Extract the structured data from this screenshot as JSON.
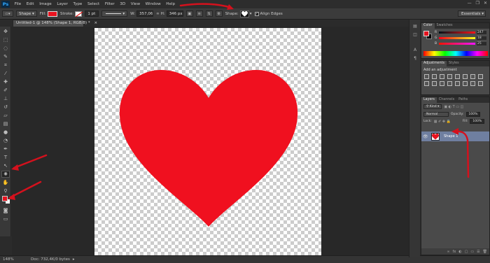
{
  "app": {
    "logo": "Ps"
  },
  "menu": [
    "File",
    "Edit",
    "Image",
    "Layer",
    "Type",
    "Select",
    "Filter",
    "3D",
    "View",
    "Window",
    "Help"
  ],
  "window_controls": [
    "—",
    "❐",
    "✕"
  ],
  "options_bar": {
    "mode": "Shape",
    "fill_label": "Fill:",
    "stroke_label": "Stroke:",
    "stroke_width": "1 pt",
    "w_label": "W:",
    "w_value": "357,06",
    "link": "∞",
    "h_label": "H:",
    "h_value": "346 px",
    "shape_label": "Shape:",
    "align_edges": "Align Edges",
    "workspace": "Essentials"
  },
  "document": {
    "tab": "Untitled-1 @ 148% (Shape 1, RGB/8) *",
    "close": "×",
    "zoom": "148%",
    "doc_info": "Doc: 732,4K/0 bytes",
    "heart_color": "#f0101f"
  },
  "color_panel": {
    "tabs": [
      "Color",
      "Swatches"
    ],
    "sliders": [
      {
        "ch": "R",
        "value": "247"
      },
      {
        "ch": "G",
        "value": "18"
      },
      {
        "ch": "B",
        "value": "25"
      }
    ]
  },
  "adjustments_panel": {
    "tabs": [
      "Adjustments",
      "Styles"
    ],
    "title": "Add an adjustment"
  },
  "layers_panel": {
    "tabs": [
      "Layers",
      "Channels",
      "Paths"
    ],
    "kind": "Kind",
    "blend": "Normal",
    "opacity_label": "Opacity:",
    "opacity": "100%",
    "lock_label": "Lock:",
    "fill_label": "Fill:",
    "fill": "100%",
    "layer_name": "Shape 1",
    "footer_icons": [
      "fx",
      "◐",
      "▢",
      "▭",
      "☰",
      "🗑"
    ]
  },
  "colors": {
    "accent_red": "#e6131f",
    "arrow_red": "#d4111d",
    "selected_layer": "#6f7fa0"
  }
}
